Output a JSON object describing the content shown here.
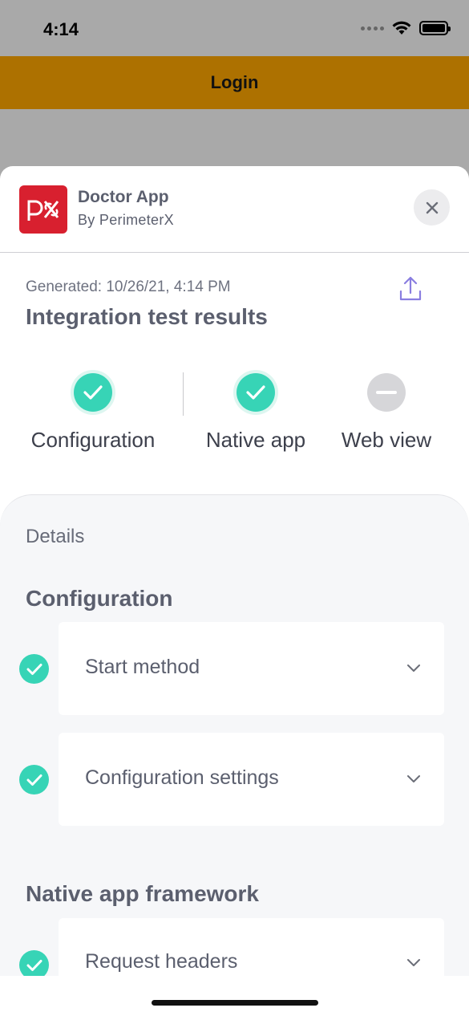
{
  "status_bar": {
    "time": "4:14",
    "icons": [
      "signal-dots-icon",
      "wifi-icon",
      "battery-icon"
    ]
  },
  "login_bar": {
    "title": "Login",
    "background_color": "#ad7100"
  },
  "sheet": {
    "app": {
      "name": "Doctor App",
      "by": "By PerimeterX",
      "logo_color": "#d8202f",
      "logo_icon": "perimeterx-logo"
    },
    "close_icon": "close-icon",
    "generated": "Generated: 10/26/21, 4:14 PM",
    "title": "Integration test results",
    "share_icon": "share-icon",
    "summary": [
      {
        "label": "Configuration",
        "status": "passed",
        "icon": "check-circle-icon"
      },
      {
        "label": "Native app",
        "status": "passed",
        "icon": "check-circle-icon"
      },
      {
        "label": "Web view",
        "status": "not-applicable",
        "icon": "minus-circle-icon"
      }
    ],
    "details": {
      "title": "Details",
      "sections": [
        {
          "title": "Configuration",
          "items": [
            {
              "label": "Start method",
              "status": "passed"
            },
            {
              "label": "Configuration settings",
              "status": "passed"
            }
          ]
        },
        {
          "title": "Native app framework",
          "items": [
            {
              "label": "Request headers",
              "status": "passed"
            }
          ]
        }
      ]
    }
  },
  "colors": {
    "success": "#37d4b6",
    "neutral": "#d6d6d9",
    "accent_share": "#8a7ee0"
  }
}
